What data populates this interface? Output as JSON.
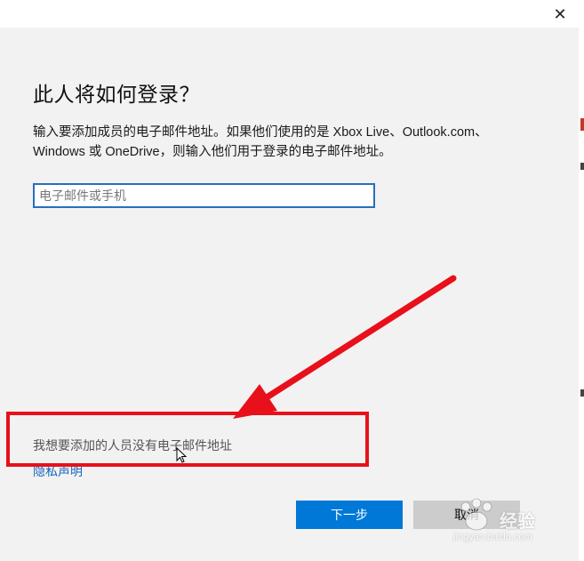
{
  "dialog": {
    "heading": "此人将如何登录？",
    "description_line1": "输入要添加成员的电子邮件地址。如果他们使用的是 Xbox Live、Outlook.com、",
    "description_line2": "Windows 或 OneDrive，则输入他们用于登录的电子邮件地址。",
    "email_input": {
      "value": "",
      "placeholder": "电子邮件或手机"
    },
    "no_email_link": "我想要添加的人员没有电子邮件地址",
    "privacy_link": "隐私声明",
    "next_button": "下一步",
    "cancel_button": "取消",
    "close_glyph": "✕"
  },
  "watermark": {
    "brand": "经验",
    "url": "jingyan.baidu.com"
  },
  "colors": {
    "accent": "#0078d7",
    "link": "#1565c0",
    "annotation": "#e8101a",
    "dialog_bg": "#f2f2f2",
    "cancel_bg": "#cccccc"
  }
}
